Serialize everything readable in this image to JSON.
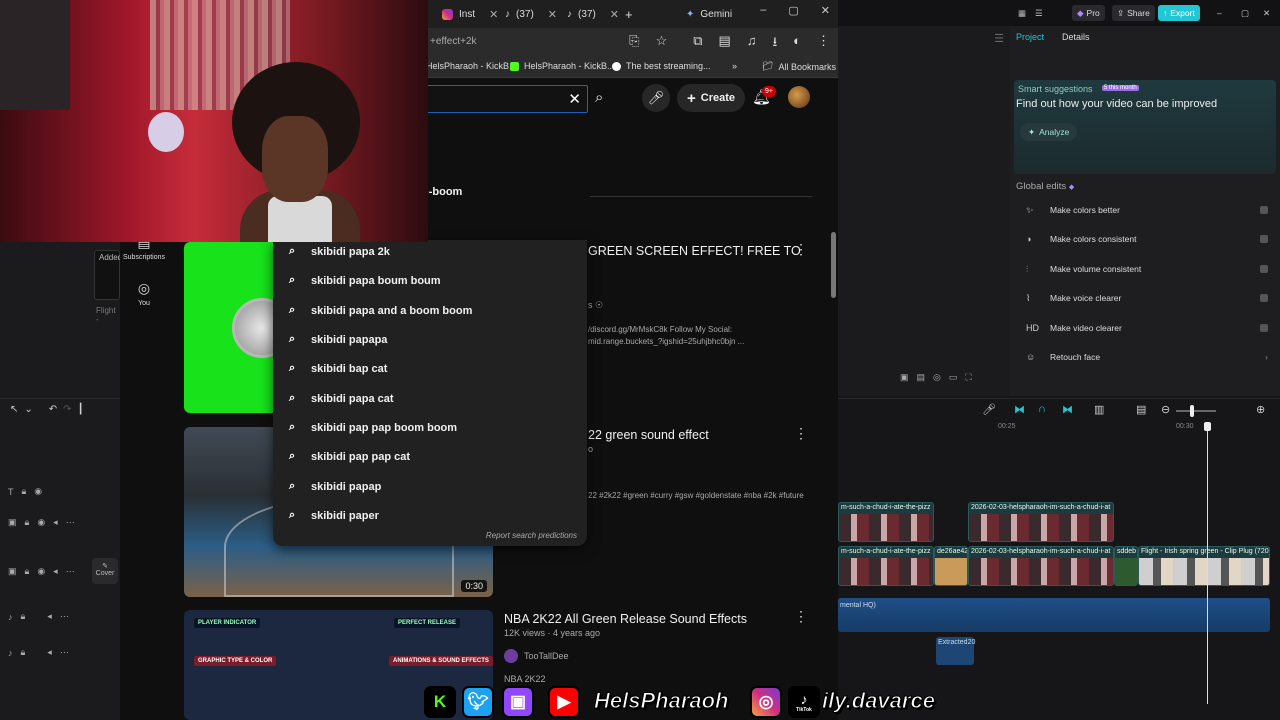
{
  "browser": {
    "tabs": [
      {
        "label": "Inst",
        "icon": "instagram-icon"
      },
      {
        "label": "(37)",
        "icon": "tiktok-icon"
      },
      {
        "label": "(37)",
        "icon": "tiktok-icon"
      },
      {
        "label": "Gemini",
        "icon": "gemini-icon"
      }
    ],
    "url_fragment": "+effect+2k",
    "bookmarks": [
      "HelsPharaoh - KickB...",
      "HelsPharaoh - KickB...",
      "The best streaming..."
    ],
    "all_bookmarks": "All Bookmarks"
  },
  "youtube": {
    "create_label": "Create",
    "notif_count": "9+",
    "sidebar": [
      {
        "label": "Subscriptions",
        "icon": "subscriptions-icon"
      },
      {
        "label": "You",
        "icon": "you-icon"
      }
    ],
    "partial_suggestion": "n-boom",
    "suggestions": [
      "skibidi papa 2k",
      "skibidi papa boum boum",
      "skibidi papa and a boom boom",
      "skibidi papapa",
      "skibidi bap cat",
      "skibidi papa cat",
      "skibidi pap pap boom boom",
      "skibidi pap pap cat",
      "skibidi papap",
      "skibidi paper"
    ],
    "report_predictions": "Report search predictions",
    "videos": [
      {
        "title": "GREEN SCREEN EFFECT! FREE TO",
        "meta": "s ☉",
        "desc_line1": "/discord.gg/MrMskC8k Follow My Social:",
        "desc_line2": "mid.range.buckets_?igshid=25uhjbhc0bjn ..."
      },
      {
        "title": "22 green sound effect",
        "meta": "o",
        "desc_line1": "22 #2k22 #green #curry #gsw #goldenstate #nba #2k #future",
        "duration": "0:30"
      },
      {
        "title": "NBA 2K22 All Green Release Sound Effects",
        "meta": "12K views · 4 years ago",
        "channel": "TooTallDee",
        "desc_line1": "NBA 2K22"
      }
    ],
    "thumb3_tags": [
      "PLAYER INDICATOR",
      "GRAPHIC TYPE & COLOR",
      "PERFECT RELEASE",
      "ANIMATIONS & SOUND EFFECTS"
    ]
  },
  "editor_left": {
    "media_label": "Added",
    "media_sub": "Flight -",
    "cover_label": "Cover"
  },
  "editor_right": {
    "pro_label": "Pro",
    "share_label": "Share",
    "export_label": "Export",
    "tabs": [
      "Project",
      "Details"
    ],
    "smart_label": "Smart suggestions",
    "smart_badge": "5 this month",
    "smart_text": "Find out how your video can be improved",
    "analyze_label": "Analyze",
    "global_edits_title": "Global edits",
    "global_edits": [
      {
        "label": "Make colors better",
        "icon": "wand-icon"
      },
      {
        "label": "Make colors consistent",
        "icon": "palette-icon"
      },
      {
        "label": "Make volume consistent",
        "icon": "equalizer-icon"
      },
      {
        "label": "Make voice clearer",
        "icon": "waveform-icon"
      },
      {
        "label": "Make video clearer",
        "icon": "hd-icon",
        "glyph": "HD"
      },
      {
        "label": "Retouch face",
        "icon": "face-icon"
      }
    ],
    "ruler": [
      "00:25",
      "00:30"
    ],
    "clips": [
      {
        "label": "m-such-a-chud-i-ate-the-pizz"
      },
      {
        "label": "2026-02-03-helspharaoh-im-such-a-chud-i-at"
      },
      {
        "label": "m-such-a-chud-i-ate-the-pizz"
      },
      {
        "label": "de26ae42"
      },
      {
        "label": "2026-02-03-helspharaoh-im-such-a-chud-i-at"
      },
      {
        "label": "sddeb"
      },
      {
        "label": "Flight - Irish spring green - Clip Plug (720"
      }
    ],
    "audio_label": "mental HQ)",
    "extracted_label": "Extracted20"
  },
  "overlay": {
    "name": "HelsPharaoh",
    "handle": "ily.davarce",
    "tiktok_caption": "TikTok"
  },
  "colors": {
    "green_screen": "#17e21a",
    "accent_teal": "#9ee3da",
    "export": "#22c7d6"
  }
}
